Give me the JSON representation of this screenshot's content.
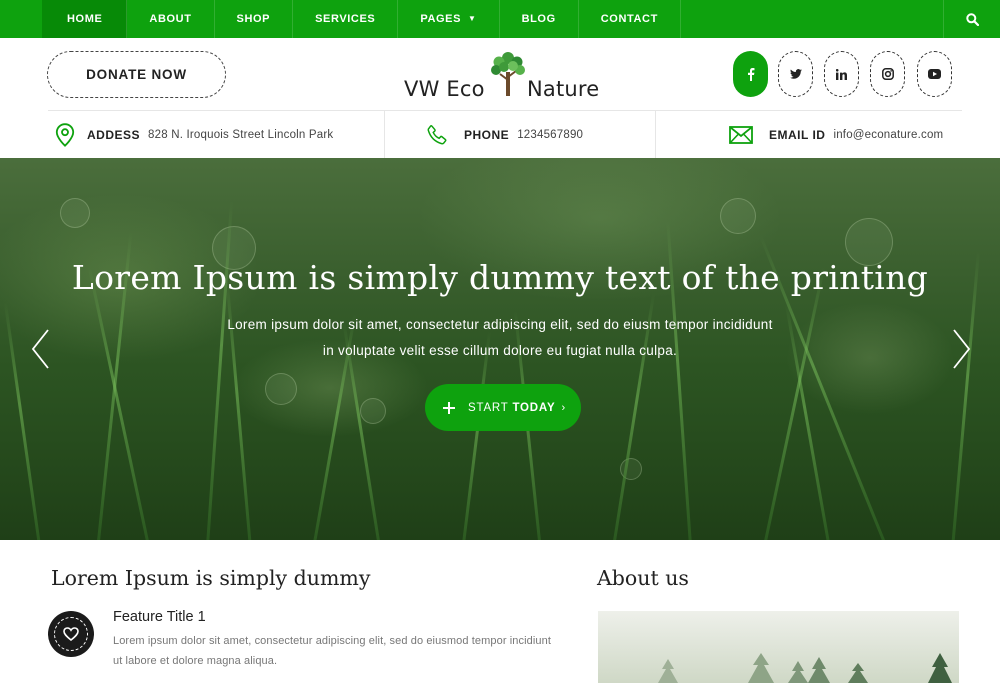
{
  "nav": {
    "items": [
      {
        "label": "HOME"
      },
      {
        "label": "ABOUT"
      },
      {
        "label": "SHOP"
      },
      {
        "label": "SERVICES"
      },
      {
        "label": "PAGES"
      },
      {
        "label": "BLOG"
      },
      {
        "label": "CONTACT"
      }
    ],
    "search_icon": "search-icon"
  },
  "header": {
    "donate_label": "DONATE NOW",
    "logo_left": "VW Eco",
    "logo_right": "Nature",
    "social": [
      "facebook-icon",
      "twitter-icon",
      "linkedin-icon",
      "instagram-icon",
      "youtube-icon"
    ]
  },
  "info": {
    "address_label": "ADDESS",
    "address_value": "828 N. Iroquois Street Lincoln Park",
    "phone_label": "PHONE",
    "phone_value": "1234567890",
    "email_label": "EMAIL ID",
    "email_value": "info@econature.com"
  },
  "hero": {
    "title": "Lorem Ipsum is simply dummy text of the printing",
    "sub_line1": "Lorem ipsum dolor sit amet, consectetur adipiscing elit, sed do eiusm tempor incididunt",
    "sub_line2": "in voluptate velit esse cillum dolore eu fugiat nulla culpa.",
    "cta_prefix": "START",
    "cta_bold": "TODAY"
  },
  "features": {
    "title": "Lorem Ipsum is simply dummy",
    "item_title": "Feature Title 1",
    "item_text_l1": "Lorem ipsum dolor sit amet, consectetur adipiscing elit, sed do eiusmod tempor incidiunt",
    "item_text_l2": "ut labore et dolore magna aliqua."
  },
  "about": {
    "title": "About us"
  },
  "colors": {
    "brand_green": "#0ea20e",
    "active_green": "#078a07"
  }
}
